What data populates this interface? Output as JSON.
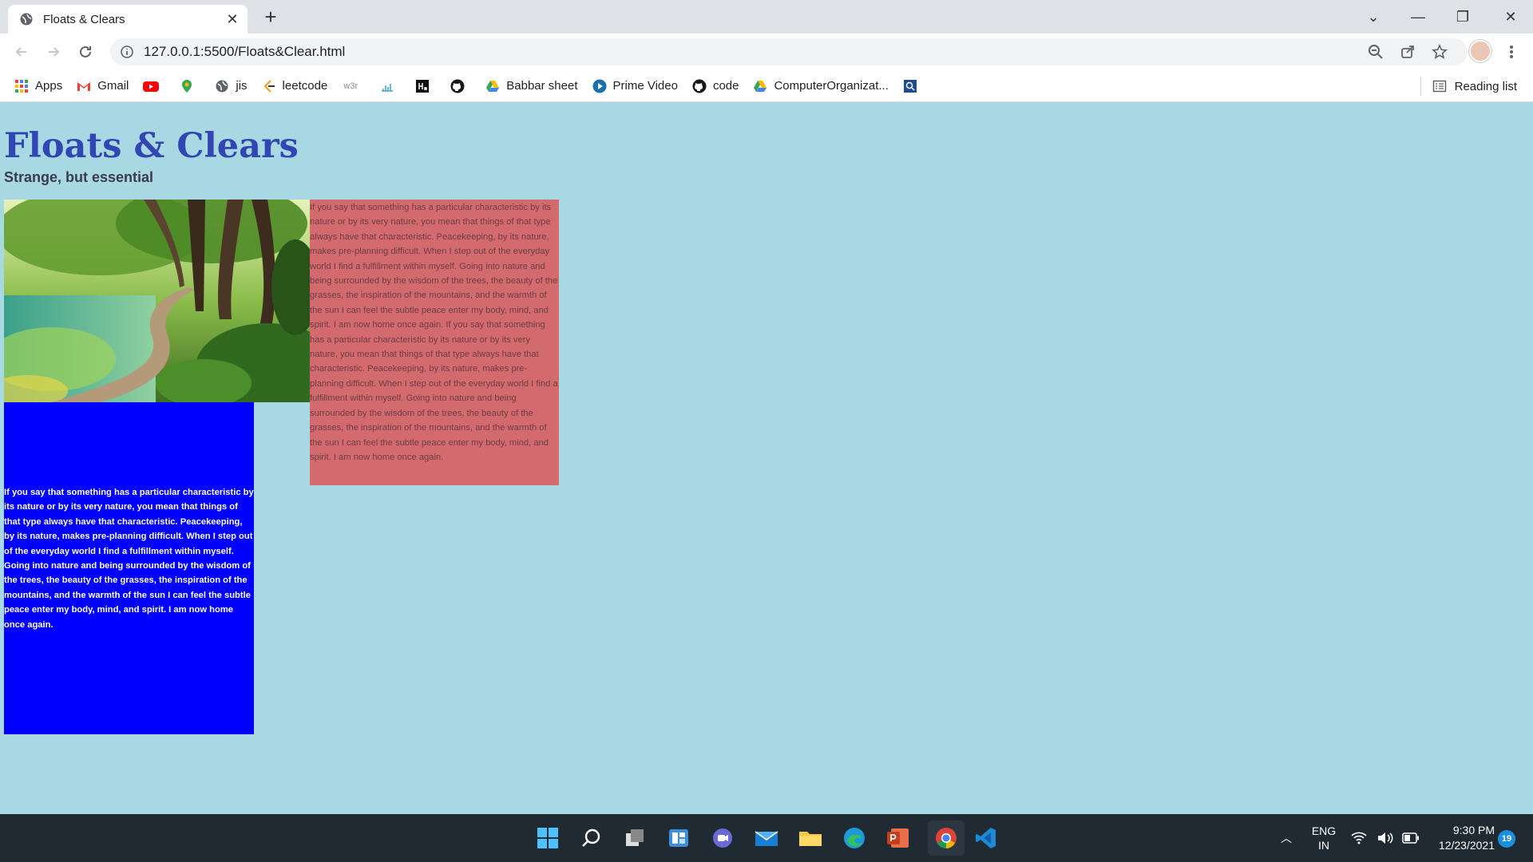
{
  "browser": {
    "tab_title": "Floats & Clears",
    "url": "127.0.0.1:5500/Floats&Clear.html",
    "bookmarks": [
      {
        "label": "Apps",
        "icon": "apps-grid-icon"
      },
      {
        "label": "Gmail",
        "icon": "gmail-icon"
      },
      {
        "label": "",
        "icon": "youtube-icon"
      },
      {
        "label": "",
        "icon": "maps-pin-icon"
      },
      {
        "label": "jis",
        "icon": "globe-icon"
      },
      {
        "label": "leetcode",
        "icon": "leetcode-icon"
      },
      {
        "label": "",
        "icon": "w3schools-icon"
      },
      {
        "label": "",
        "icon": "chart-icon"
      },
      {
        "label": "",
        "icon": "hackerrank-icon"
      },
      {
        "label": "",
        "icon": "github-icon"
      },
      {
        "label": "Babbar sheet",
        "icon": "drive-icon"
      },
      {
        "label": "Prime Video",
        "icon": "prime-video-icon"
      },
      {
        "label": "code",
        "icon": "github-icon"
      },
      {
        "label": "ComputerOrganizat...",
        "icon": "drive-icon"
      },
      {
        "label": "",
        "icon": "search-box-icon"
      }
    ],
    "reading_list": "Reading list"
  },
  "page": {
    "title": "Floats & Clears",
    "subtitle": "Strange, but essential",
    "float_text": "If you say that something has a particular characteristic by its nature or by its very nature, you mean that things of that type always have that characteristic. Peacekeeping, by its nature, makes pre-planning difficult. When I step out of the everyday world I find a fulfillment within myself. Going into nature and being surrounded by the wisdom of the trees, the beauty of the grasses, the inspiration of the mountains, and the warmth of the sun I can feel the subtle peace enter my body, mind, and spirit. I am now home once again. If you say that something has a particular characteristic by its nature or by its very nature, you mean that things of that type always have that characteristic. Peacekeeping, by its nature, makes pre-planning difficult. When I step out of the everyday world I find a fulfillment within myself. Going into nature and being surrounded by the wisdom of the trees, the beauty of the grasses, the inspiration of the mountains, and the warmth of the sun I can feel the subtle peace enter my body, mind, and spirit. I am now home once again.",
    "clear_text": "If you say that something has a particular characteristic by its nature or by its very nature, you mean that things of that type always have that characteristic. Peacekeeping, by its nature, makes pre-planning difficult. When I step out of the everyday world I find a fulfillment within myself. Going into nature and being surrounded by the wisdom of the trees, the beauty of the grasses, the inspiration of the mountains, and the warmth of the sun I can feel the subtle peace enter my body, mind, and spirit. I am now home once again."
  },
  "taskbar": {
    "lang": "ENG",
    "region": "IN",
    "time": "9:30 PM",
    "date": "12/23/2021",
    "notifications": "19"
  },
  "colors": {
    "page_bg": "#a8d9e3",
    "title": "#3146b3",
    "float_box": "#d36b6e",
    "clear_box": "#0000ff"
  }
}
